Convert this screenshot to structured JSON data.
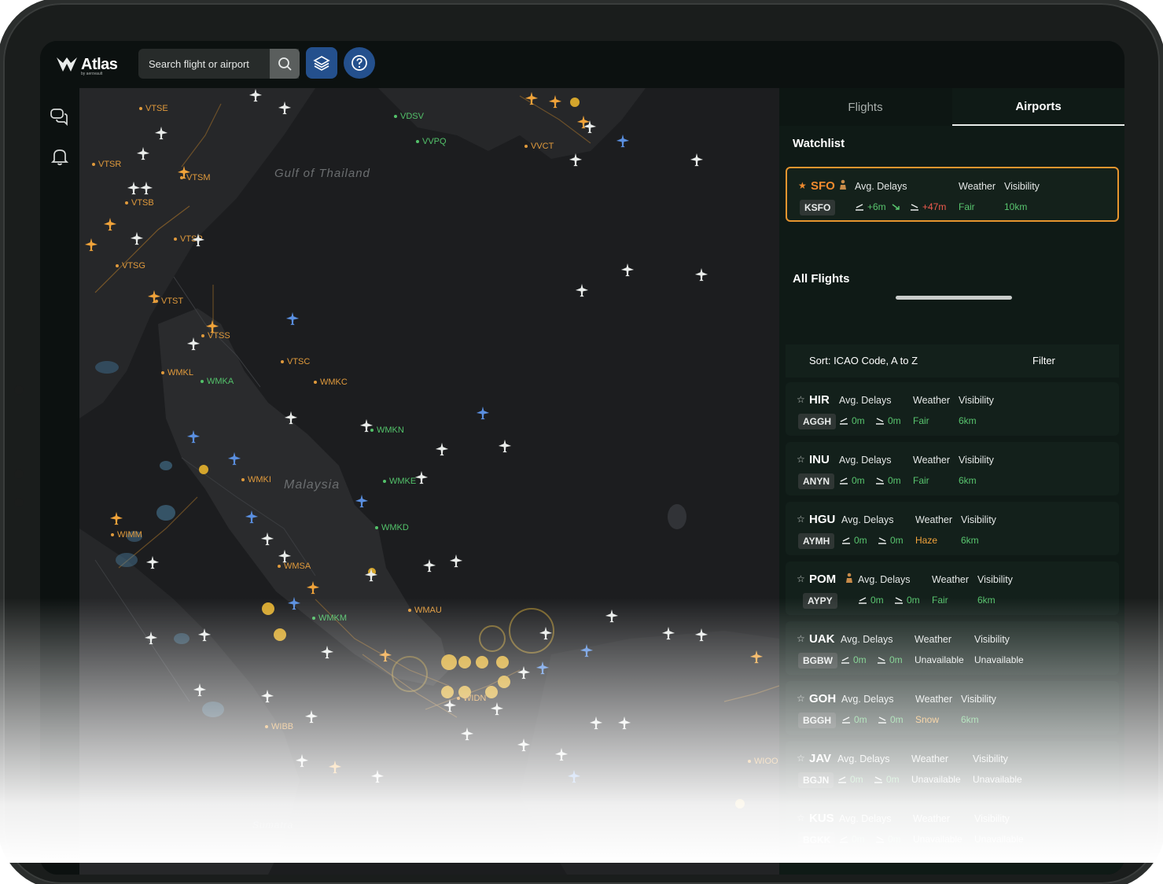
{
  "app": {
    "name": "Atlas",
    "byline": "by aerovault"
  },
  "search": {
    "placeholder": "Search flight or airport"
  },
  "tabs": [
    {
      "label": "Flights"
    },
    {
      "label": "Airports"
    }
  ],
  "watchlist": {
    "title": "Watchlist",
    "item": {
      "code": "SFO",
      "icao": "KSFO",
      "avg_label": "Avg. Delays",
      "weather_label": "Weather",
      "visibility_label": "Visibility",
      "dep_delay": "+6m",
      "arr_delay": "+47m",
      "weather": "Fair",
      "visibility": "10km"
    }
  },
  "all_flights": {
    "title": "All Flights",
    "sort_label": "Sort: ICAO Code, A to Z",
    "filter_label": "Filter",
    "items": [
      {
        "code": "HIR",
        "icao": "AGGH",
        "avg_label": "Avg. Delays",
        "weather_label": "Weather",
        "visibility_label": "Visibility",
        "dep_delay": "0m",
        "arr_delay": "0m",
        "weather": "Fair",
        "visibility": "6km"
      },
      {
        "code": "INU",
        "icao": "ANYN",
        "avg_label": "Avg. Delays",
        "weather_label": "Weather",
        "visibility_label": "Visibility",
        "dep_delay": "0m",
        "arr_delay": "0m",
        "weather": "Fair",
        "visibility": "6km"
      },
      {
        "code": "HGU",
        "icao": "AYMH",
        "avg_label": "Avg. Delays",
        "weather_label": "Weather",
        "visibility_label": "Visibility",
        "dep_delay": "0m",
        "arr_delay": "0m",
        "weather": "Haze",
        "visibility": "6km"
      },
      {
        "code": "POM",
        "icao": "AYPY",
        "avg_label": "Avg. Delays",
        "weather_label": "Weather",
        "visibility_label": "Visibility",
        "dep_delay": "0m",
        "arr_delay": "0m",
        "weather": "Fair",
        "visibility": "6km"
      },
      {
        "code": "UAK",
        "icao": "BGBW",
        "avg_label": "Avg. Delays",
        "weather_label": "Weather",
        "visibility_label": "Visibility",
        "dep_delay": "0m",
        "arr_delay": "0m",
        "weather": "Unavailable",
        "visibility": "Unavailable"
      },
      {
        "code": "GOH",
        "icao": "BGGH",
        "avg_label": "Avg. Delays",
        "weather_label": "Weather",
        "visibility_label": "Visibility",
        "dep_delay": "0m",
        "arr_delay": "0m",
        "weather": "Snow",
        "visibility": "6km"
      },
      {
        "code": "JAV",
        "icao": "BGJN",
        "avg_label": "Avg. Delays",
        "weather_label": "Weather",
        "visibility_label": "Visibility",
        "dep_delay": "0m",
        "arr_delay": "0m",
        "weather": "Unavailable",
        "visibility": "Unavailable"
      },
      {
        "code": "KUS",
        "icao": "BGKK",
        "avg_label": "Avg. Delays",
        "weather_label": "Weather",
        "visibility_label": "Visibility",
        "dep_delay": "0m",
        "arr_delay": "0m",
        "weather": "Unavailable",
        "visibility": "Unavailable"
      }
    ]
  },
  "map": {
    "regions": {
      "gulf": "Gulf of Thailand",
      "malaysia": "Malaysia",
      "sumatra": "Sumatra"
    },
    "airports_orange": [
      "VTSE",
      "VTSR",
      "VTSM",
      "VTSB",
      "VTSP",
      "VTSG",
      "VTST",
      "VTSS",
      "VTSC",
      "WMKL",
      "WMKC",
      "WMKI",
      "WIMM",
      "WMSA",
      "WMAU",
      "WIDN",
      "WIBB",
      "WIOO",
      "VVCT"
    ],
    "airports_green": [
      "VDSV",
      "VVPQ",
      "WMKA",
      "WMKN",
      "WMKE",
      "WMKD",
      "WMKM"
    ]
  }
}
